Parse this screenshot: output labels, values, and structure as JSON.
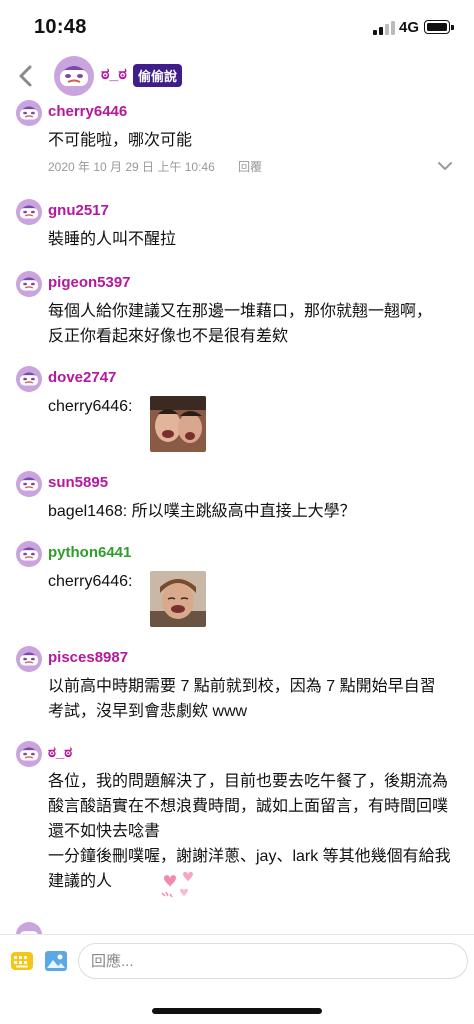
{
  "status_bar": {
    "time": "10:48",
    "network": "4G"
  },
  "header": {
    "name": "ಠ_ಠ",
    "badge": "偷偷說"
  },
  "comments": [
    {
      "author": "cherry6446",
      "text": "不可能啦，哪次可能",
      "timestamp": "2020 年 10 月 29 日 上午 10:46",
      "reply_label": "回覆"
    },
    {
      "author": "gnu2517",
      "text": "裝睡的人叫不醒拉"
    },
    {
      "author": "pigeon5397",
      "text": "每個人給你建議又在那邊一堆藉口，那你就翹一翹啊，反正你看起來好像也不是很有差欸"
    },
    {
      "author": "dove2747",
      "text": "cherry6446:"
    },
    {
      "author": "sun5895",
      "text": "bagel1468: 所以噗主跳級高中直接上大學？"
    },
    {
      "author": "python6441",
      "text": "cherry6446:"
    },
    {
      "author": "pisces8987",
      "text": "以前高中時期需要 7 點前就到校，因為 7 點開始早自習考試，沒早到會悲劇欸 www"
    },
    {
      "author": "ಠ_ಠ",
      "text": "各位，我的問題解決了，目前也要去吃午餐了，後期流為酸言酸語實在不想浪費時間，誠如上面留言，有時間回噗還不如快去唸書\n一分鐘後刪噗喔，謝謝洋蔥、jay、lark 等其他幾個有給我建議的人"
    }
  ],
  "input": {
    "placeholder": "回應..."
  },
  "icons": {
    "back": "chevron-left-icon",
    "expand": "chevron-down-icon",
    "emoji": "emoji-keyboard-icon",
    "image": "image-icon",
    "sticker": "hearts-sticker"
  },
  "colors": {
    "author": "#b5179e",
    "author_green": "#2e9d2a",
    "badge_bg": "#3f1d8a",
    "muted": "#999999"
  }
}
